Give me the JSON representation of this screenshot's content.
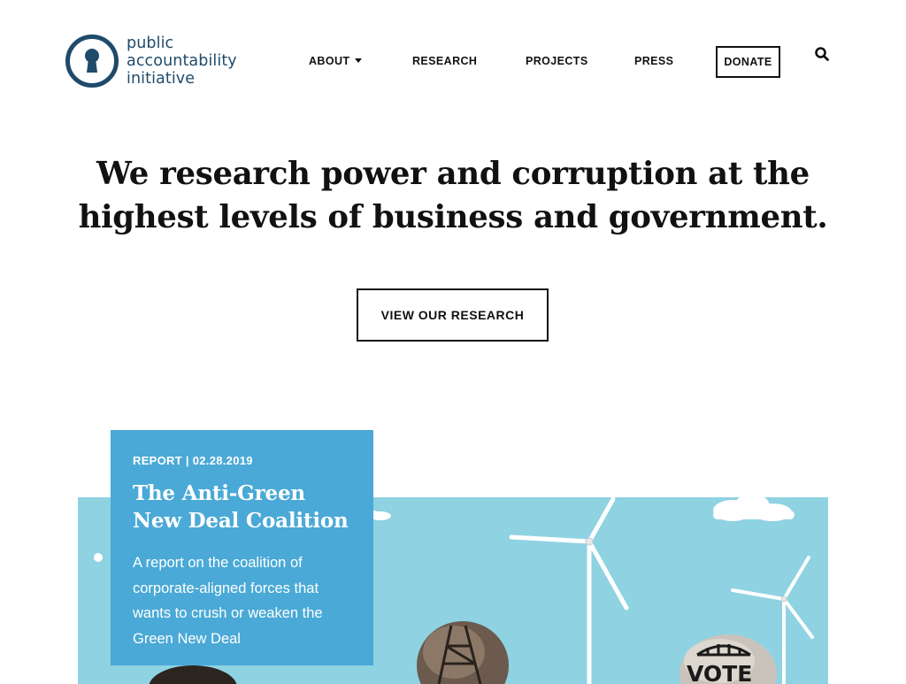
{
  "header": {
    "logo": {
      "line1": "public",
      "line2": "accountability",
      "line3": "initiative",
      "icon": "keyhole-icon",
      "color": "#1f4b6b"
    },
    "nav": {
      "about": "ABOUT",
      "research": "RESEARCH",
      "projects": "PROJECTS",
      "press": "PRESS",
      "donate": "DONATE",
      "search_icon": "search-icon"
    }
  },
  "hero": {
    "title_line1": "We research power and corruption at the",
    "title_line2": "highest levels of business and government.",
    "cta": "VIEW OUR RESEARCH"
  },
  "feature": {
    "meta": "REPORT | 02.28.2019",
    "title_line1": "The Anti-Green",
    "title_line2": "New Deal Coalition",
    "desc_line1": "A report on the coalition of",
    "desc_line2": "corporate-aligned forces that",
    "desc_line3": "wants to crush or weaken the",
    "desc_line4": "Green New Deal",
    "image_sign_text": "VOTE",
    "colors": {
      "card": "#4aa9d6",
      "sky": "#8fd2e2"
    }
  }
}
